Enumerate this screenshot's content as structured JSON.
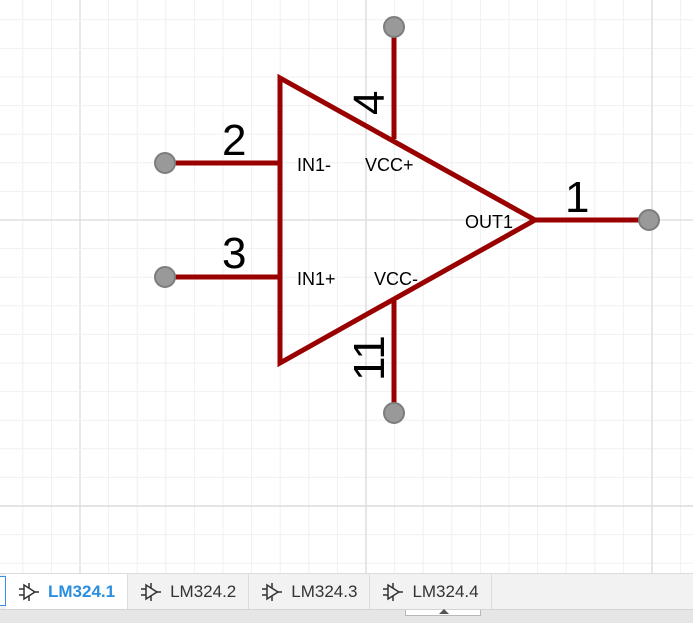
{
  "schematic": {
    "pin_numbers": {
      "in_minus": "2",
      "in_plus": "3",
      "vcc_plus": "4",
      "vcc_minus": "11",
      "out": "1"
    },
    "pin_names": {
      "in_minus": "IN1-",
      "in_plus": "IN1+",
      "vcc_plus": "VCC+",
      "vcc_minus": "VCC-",
      "out": "OUT1"
    },
    "colors": {
      "wire": "#990000",
      "pin_end": "#999999",
      "grid_minor": "#f0f0f0",
      "grid_major": "#dadada"
    }
  },
  "tabs": [
    {
      "label": "LM324.1",
      "icon": "opamp-icon",
      "active": true
    },
    {
      "label": "LM324.2",
      "icon": "opamp-icon",
      "active": false
    },
    {
      "label": "LM324.3",
      "icon": "opamp-icon",
      "active": false
    },
    {
      "label": "LM324.4",
      "icon": "opamp-icon",
      "active": false
    }
  ],
  "colors": {
    "accent": "#2b8fe0",
    "tab_bar": "#f2f2f2"
  }
}
